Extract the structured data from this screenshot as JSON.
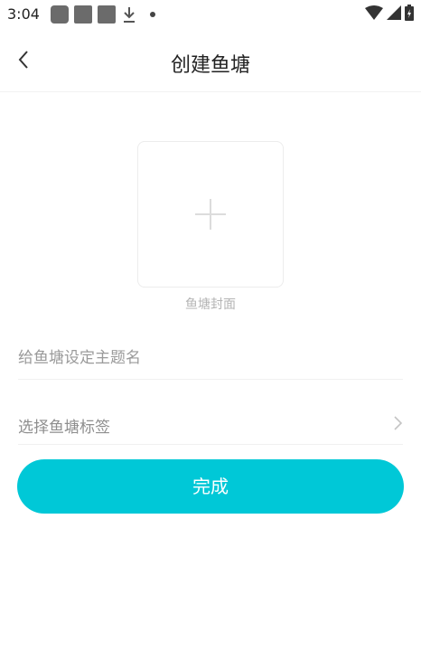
{
  "status_bar": {
    "time": "3:04",
    "left_icons": [
      "app-notification-icon",
      "app-notification-icon",
      "app-notification-icon",
      "download-icon",
      "dot-icon"
    ],
    "right_icons": [
      "wifi-icon",
      "signal-icon",
      "battery-icon"
    ]
  },
  "nav": {
    "title": "创建鱼塘",
    "back_icon": "chevron-left-icon"
  },
  "cover": {
    "label": "鱼塘封面",
    "icon": "plus-icon"
  },
  "form": {
    "title_placeholder": "给鱼塘设定主题名",
    "title_value": "",
    "tag_label": "选择鱼塘标签",
    "tag_icon": "chevron-right-icon"
  },
  "actions": {
    "done_label": "完成"
  },
  "colors": {
    "accent": "#00c8d7",
    "placeholder": "#9a9a9a",
    "divider": "#f0f0f0"
  }
}
